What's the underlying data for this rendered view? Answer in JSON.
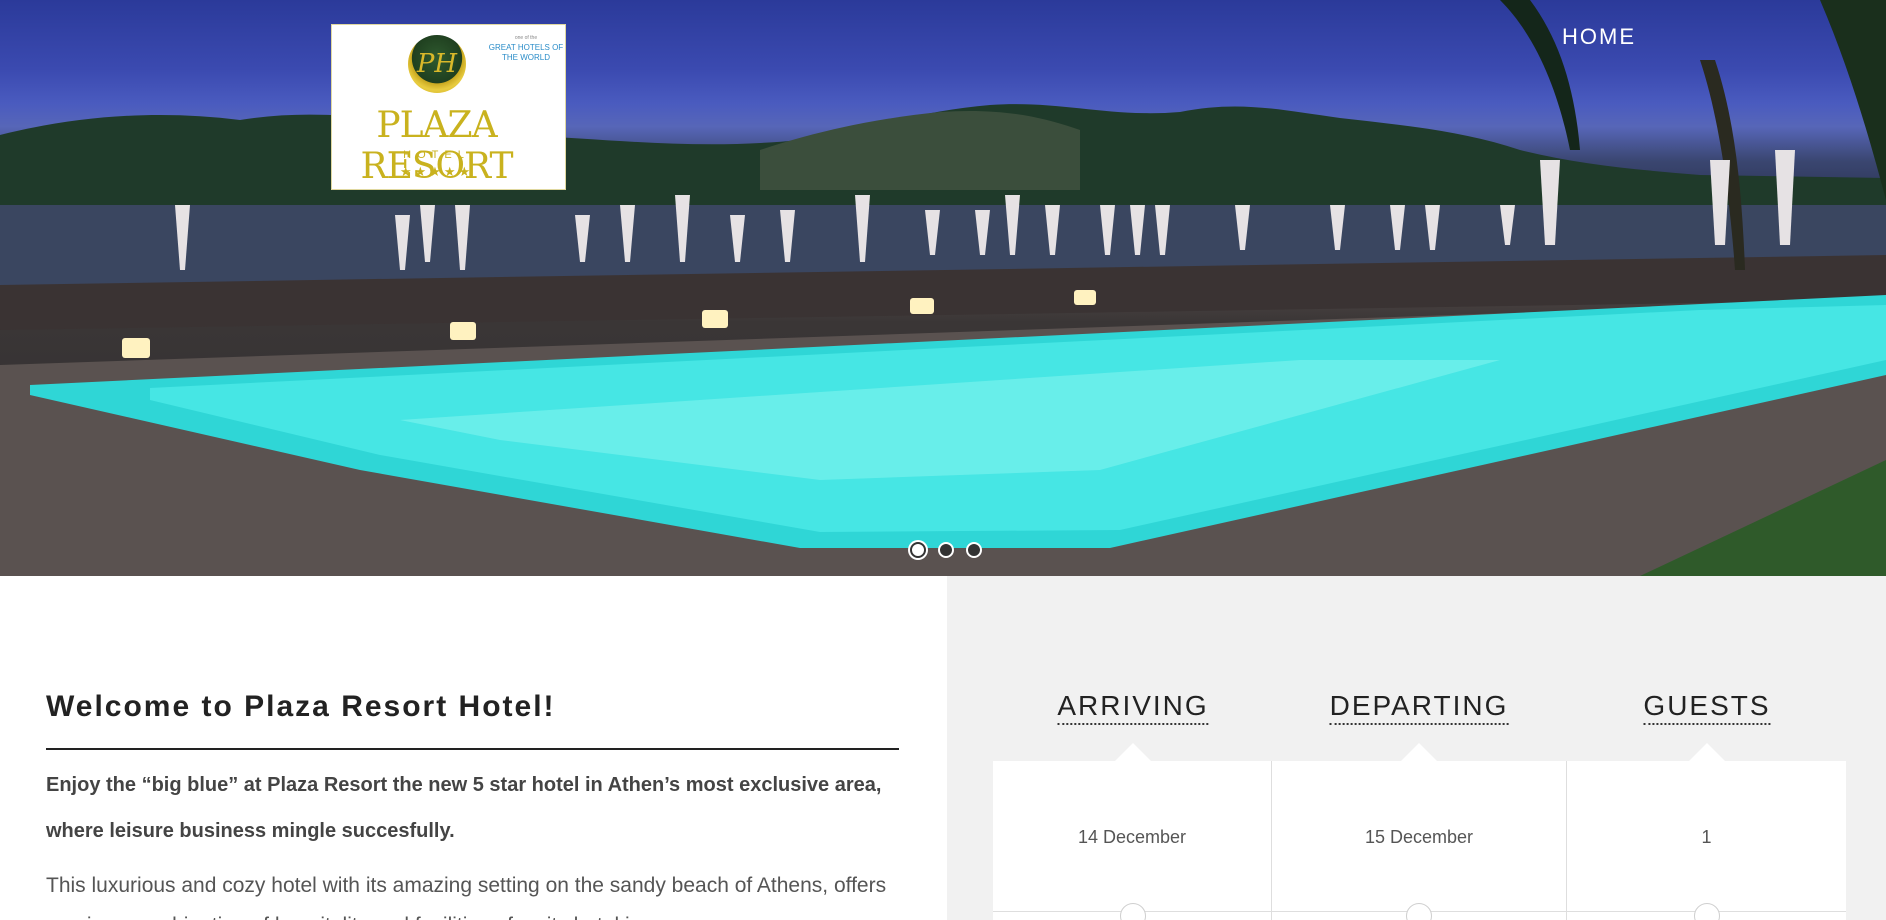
{
  "nav": {
    "home_label": "HOME"
  },
  "logo": {
    "badge": "PH",
    "affiliation_small": "one of the",
    "affiliation": "GREAT HOTELS OF THE WORLD",
    "name": "PLAZA RESORT",
    "subtitle": "HOTEL",
    "stars": "★★★★★"
  },
  "slider": {
    "slide_count": 3,
    "active_index": 0
  },
  "welcome": {
    "title": "Welcome to Plaza Resort Hotel!",
    "intro": "Enjoy the “big blue” at Plaza Resort the new 5 star hotel in Athen’s most exclusive area, where leisure business mingle succesfully.",
    "body": "This luxurious and cozy hotel with its amazing setting on the sandy beach of Athens, offers a unique combination of hospitality and facilities of a city hotel in"
  },
  "booking": {
    "arriving_label": "ARRIVING",
    "departing_label": "DEPARTING",
    "guests_label": "GUESTS",
    "arriving_value": "14 December",
    "departing_value": "15 December",
    "guests_value": "1"
  }
}
